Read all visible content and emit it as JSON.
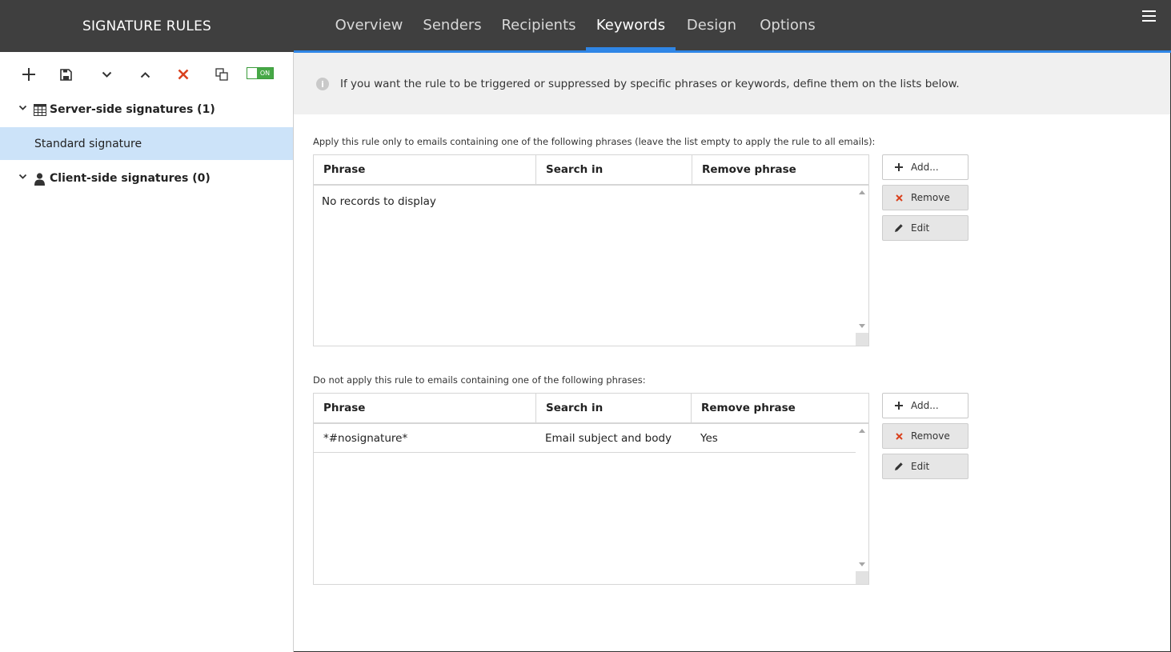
{
  "sidebar": {
    "title": "SIGNATURE RULES",
    "toolbar": {
      "add": "add-icon",
      "save": "save-icon",
      "move_down": "chevron-down-icon",
      "move_up": "chevron-up-icon",
      "delete": "delete-icon",
      "duplicate": "duplicate-icon",
      "toggle_label": "ON"
    },
    "groups": [
      {
        "label": "Server-side signatures (1)",
        "icon": "server-icon",
        "items": [
          {
            "label": "Standard signature",
            "selected": true
          }
        ]
      },
      {
        "label": "Client-side signatures (0)",
        "icon": "user-icon",
        "items": []
      }
    ]
  },
  "nav": {
    "tabs": [
      {
        "label": "Overview"
      },
      {
        "label": "Senders"
      },
      {
        "label": "Recipients"
      },
      {
        "label": "Keywords",
        "active": true
      },
      {
        "label": "Design"
      },
      {
        "label": "Options"
      }
    ],
    "menu_icon": "hamburger-icon"
  },
  "info": {
    "icon": "info-icon",
    "text": "If you want the rule to be triggered or suppressed by specific phrases or keywords, define them on the lists below."
  },
  "include_list": {
    "label": "Apply this rule only to emails containing one of the following phrases (leave the list empty to apply the rule to all emails):",
    "columns": [
      "Phrase",
      "Search in",
      "Remove phrase"
    ],
    "empty_message": "No records to display",
    "rows": [],
    "buttons": {
      "add": "Add...",
      "remove": "Remove",
      "edit": "Edit"
    }
  },
  "exclude_list": {
    "label": "Do not apply this rule to emails containing one of the following phrases:",
    "columns": [
      "Phrase",
      "Search in",
      "Remove phrase"
    ],
    "rows": [
      {
        "phrase": "*#nosignature*",
        "search_in": "Email subject and body",
        "remove_phrase": "Yes"
      }
    ],
    "buttons": {
      "add": "Add...",
      "remove": "Remove",
      "edit": "Edit"
    }
  },
  "colors": {
    "header_bg": "#3f3f3f",
    "accent": "#2f86e6",
    "selected_row": "#cce3f9",
    "delete_red": "#d9411e",
    "toggle_green": "#46a846"
  }
}
